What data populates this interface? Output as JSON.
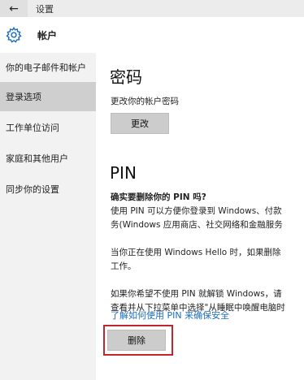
{
  "window": {
    "back_glyph": "←",
    "title": "设置"
  },
  "header": {
    "icon": "gear-icon",
    "title": "帐户"
  },
  "sidebar": {
    "items": [
      {
        "label": "你的电子邮件和帐户",
        "selected": false
      },
      {
        "label": "登录选项",
        "selected": true
      },
      {
        "label": "工作单位访问",
        "selected": false
      },
      {
        "label": "家庭和其他用户",
        "selected": false
      },
      {
        "label": "同步你的设置",
        "selected": false
      }
    ]
  },
  "password": {
    "heading": "密码",
    "description": "更改你的帐户密码",
    "change_button": "更改"
  },
  "pin": {
    "heading": "PIN",
    "confirm_title": "确实要删除你的 PIN 吗?",
    "para1_line1": "使用 PIN 可以方便你登录到 Windows、付款",
    "para1_line2": "务(Windows 应用商店、社交网络和金融服务",
    "para2_line1": "当你正在使用 Windows Hello 时，如果删除",
    "para2_line2": "工作。",
    "para3_line1": "如果你希望不使用 PIN 就解锁 Windows，请",
    "para3_line2": "查看并从下拉菜单中选择\"从睡眠中唤醒电脑时",
    "learn_link": "了解如何使用 PIN 来确保安全",
    "delete_button": "删除"
  },
  "colors": {
    "sidebar_bg": "#f2f2f2",
    "selected_item_bg": "#cfcfcf",
    "link": "#1a6fc2",
    "highlight_border": "#c0262d",
    "button_bg": "#cccccc"
  }
}
